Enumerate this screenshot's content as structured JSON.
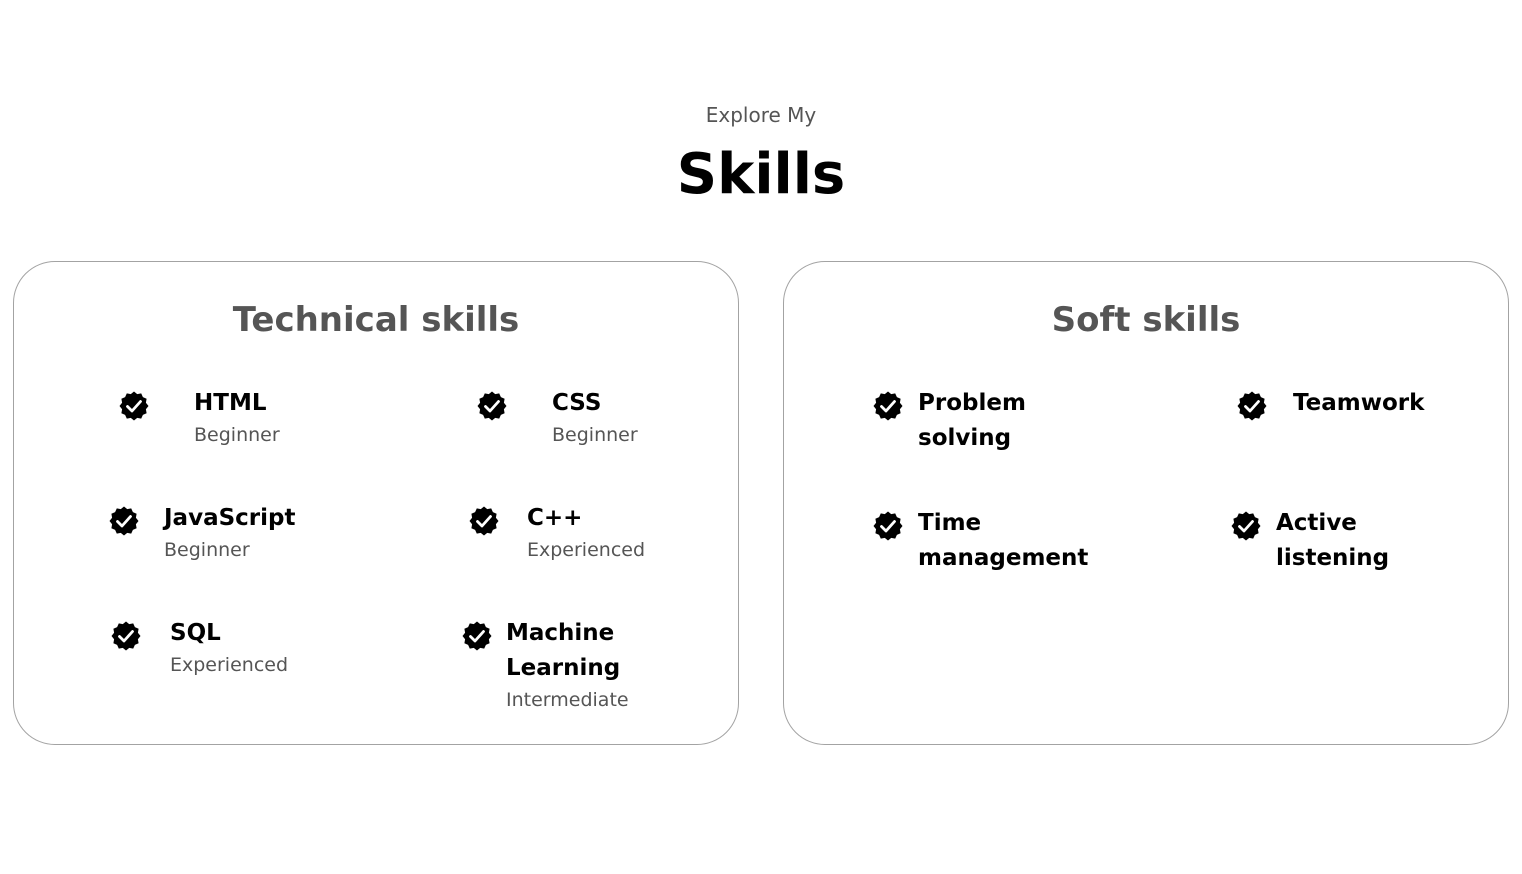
{
  "header": {
    "subtitle": "Explore My",
    "title": "Skills"
  },
  "technical": {
    "title": "Technical skills",
    "items": [
      {
        "name": "HTML",
        "level": "Beginner"
      },
      {
        "name": "CSS",
        "level": "Beginner"
      },
      {
        "name": "JavaScript",
        "level": "Beginner"
      },
      {
        "name": "C++",
        "level": "Experienced"
      },
      {
        "name": "SQL",
        "level": "Experienced"
      },
      {
        "name_line1": "Machine",
        "name_line2": "Learning",
        "level": "Intermediate"
      }
    ]
  },
  "soft": {
    "title": "Soft skills",
    "items": [
      {
        "name_line1": "Problem",
        "name_line2": "solving"
      },
      {
        "name": "Teamwork"
      },
      {
        "name_line1": "Time",
        "name_line2": "management"
      },
      {
        "name_line1": "Active",
        "name_line2": "listening"
      }
    ]
  },
  "colors": {
    "muted": "#555555",
    "border": "#a3a3a3",
    "icon": "#000000"
  },
  "icons": {
    "badge": "verified-check-icon"
  }
}
